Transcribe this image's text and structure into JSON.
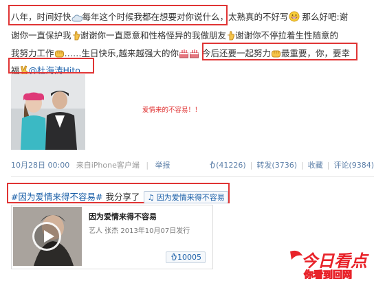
{
  "post": {
    "lines": [
      {
        "p1": "八年，时间好快",
        "p2": "每年这个时候我都在想要对你说什么，",
        "p3": "太熟真的不好写",
        "p4": "那么好吧:谢"
      },
      {
        "p1": "谢你一直保护我",
        "p2": "谢谢你一直愿意和性格怪异的我做朋友",
        "p3": "谢谢你不停拉着生性随意的"
      },
      {
        "p1": "我努力工作",
        "p2": "……生日快乐,越来越强大的你",
        "p3": "今后还要一起努力",
        "p4": "最重要，你，要幸"
      },
      {
        "p1": "福",
        "mention": "@杜海涛Hito"
      }
    ],
    "caption": "爱情来的不容易！！",
    "meta": {
      "date": "10月28日 00:00",
      "source": "来自iPhone客户端",
      "report": "举报",
      "likes": "(41226)",
      "repost": "转发(3736)",
      "favorite": "收藏",
      "comment": "评论(9384)"
    }
  },
  "share": {
    "hashtag": "#因为爱情来得不容易#",
    "text": "我分享了",
    "music_tag": "因为爱情来得不容易",
    "card": {
      "title": "因为爱情来得不容易",
      "meta": "艺人 张杰 2013年10月07日发行",
      "likes": "10005"
    }
  },
  "watermark": {
    "text": "今日看点",
    "sub": "你看到回网"
  },
  "colors": {
    "highlight": "#e03434",
    "link": "#1a5fa8",
    "meta": "#5c7fa8"
  }
}
